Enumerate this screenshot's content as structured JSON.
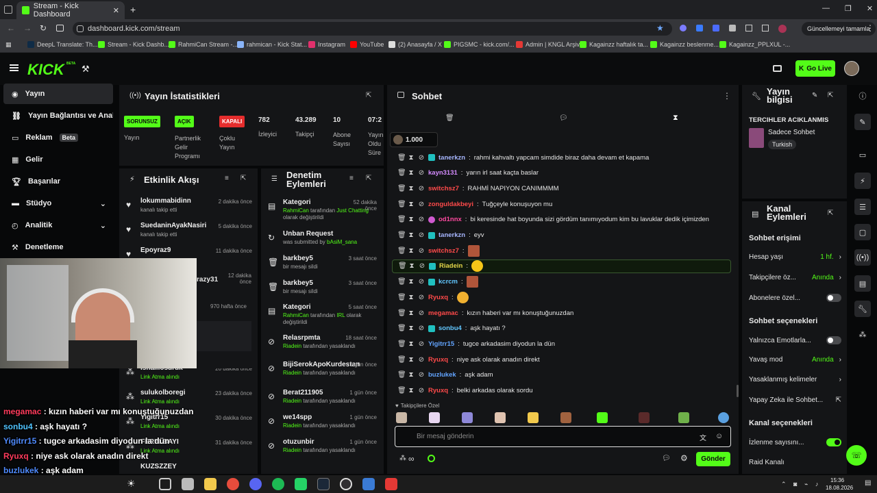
{
  "browser": {
    "tab_title": "Stream - Kick Dashboard",
    "url": "dashboard.kick.com/stream",
    "update_button": "Güncellemeyi tamamla",
    "bookmarks": [
      "DeepL Translate: Th...",
      "Stream - Kick Dashb...",
      "RahmiCan Stream -...",
      "rahmican - Kick Stat...",
      "Instagram",
      "YouTube",
      "(2) Anasayfa / X",
      "PIGSMC - kick.com/...",
      "Admin | KNGL Arşiv",
      "Kagainzz haftalık ta...",
      "Kagainzz beslenme...",
      "Kagainzz_PPLXUL -..."
    ]
  },
  "header": {
    "logo": "KICK",
    "beta": "BETA",
    "go_live": "Go Live"
  },
  "sidebar": {
    "items": [
      {
        "label": "Yayın"
      },
      {
        "label": "Yayın Bağlantısı ve Anahtarı"
      },
      {
        "label": "Reklam",
        "badge": "Beta"
      },
      {
        "label": "Gelir"
      },
      {
        "label": "Başarılar"
      },
      {
        "label": "Stüdyo"
      },
      {
        "label": "Analitik"
      },
      {
        "label": "Denetleme"
      }
    ]
  },
  "stats": {
    "title": "Yayın İstatistikleri",
    "cols": [
      {
        "badge": "SORUNSUZ",
        "label": "Yayın"
      },
      {
        "badge": "AÇIK",
        "label": "Partnerlik Gelir Programı"
      },
      {
        "badge": "KAPALI",
        "label": "Çoklu Yayın"
      },
      {
        "value": "782",
        "label": "İzleyici"
      },
      {
        "value": "43.289",
        "label": "Takipçi"
      },
      {
        "value": "10",
        "label": "Abone Sayısı"
      },
      {
        "value": "07:2",
        "label": "Yayın Oldu Süre"
      }
    ]
  },
  "activity": {
    "title": "Etkinlik Akışı",
    "items": [
      {
        "name": "lokummabidinn",
        "sub": "kanalı takip etti",
        "ago": "2 dakika önce"
      },
      {
        "name": "SuedaninAyakNasiri",
        "sub": "kanalı takip etti",
        "ago": "5 dakika önce"
      },
      {
        "name": "Epoyraz9",
        "sub": "",
        "ago": "11 dakika önce"
      },
      {
        "name": "razy31",
        "sub": "",
        "ago": "12 dakika önce"
      },
      {
        "name": "",
        "sub": "",
        "ago": "970 hafta önce"
      },
      {
        "name": "ishalliosuruk",
        "sub": "Link Atma alındı",
        "ago": "20 dakika önce"
      },
      {
        "name": "sulukolboregi",
        "sub": "Link Atma alındı",
        "ago": "23 dakika önce"
      },
      {
        "name": "Yigitrr15",
        "sub": "Link Atma alındı",
        "ago": "30 dakika önce"
      },
      {
        "name": "FERELBAYI",
        "sub": "Link Atma alındı",
        "ago": "31 dakika önce"
      },
      {
        "name": "KUZSZZEY",
        "sub": "",
        "ago": ""
      }
    ]
  },
  "moderation": {
    "title": "Denetim Eylemleri",
    "items": [
      {
        "name": "Kategori",
        "actor": "RahmiCan",
        "mid": " tarafından ",
        "hl": "Just Chatting",
        "tail": " olarak değiştirildi",
        "ago": "52 dakika önce"
      },
      {
        "name": "Unban Request",
        "actor": "",
        "mid": "was submitted by ",
        "hl": "bAsiM_sana",
        "tail": "",
        "ago": ""
      },
      {
        "name": "barkbey5",
        "actor": "",
        "mid": "bir mesajı sildi",
        "hl": "",
        "tail": "",
        "ago": "3 saat önce"
      },
      {
        "name": "barkbey5",
        "actor": "",
        "mid": "bir mesajı sildi",
        "hl": "",
        "tail": "",
        "ago": "3 saat önce"
      },
      {
        "name": "Kategori",
        "actor": "RahmiCan",
        "mid": " tarafından ",
        "hl": "IRL",
        "tail": " olarak değiştirildi",
        "ago": "5 saat önce"
      },
      {
        "name": "Relasrpmta",
        "actor": "Riadein",
        "mid": " tarafından yasaklandı",
        "hl": "",
        "tail": "",
        "ago": "18 saat önce"
      },
      {
        "name": "BijiSerokApoKurdestan21",
        "actor": "Riadein",
        "mid": " tarafından yasaklandı",
        "hl": "",
        "tail": "",
        "ago": "1 gün önce"
      },
      {
        "name": "Berat211905",
        "actor": "Riadein",
        "mid": " tarafından yasaklandı",
        "hl": "",
        "tail": "",
        "ago": "1 gün önce"
      },
      {
        "name": "we14spp",
        "actor": "Riadein",
        "mid": " tarafından yasaklandı",
        "hl": "",
        "tail": "",
        "ago": "1 gün önce"
      },
      {
        "name": "otuzunbir",
        "actor": "Riadein",
        "mid": " tarafından yasaklandı",
        "hl": "",
        "tail": "",
        "ago": "1 gün önce"
      }
    ]
  },
  "chat": {
    "title": "Sohbet",
    "pinned_amount": "1.000",
    "messages": [
      {
        "user": "tanerkzn",
        "color": "#a7b6ff",
        "text": "rahmi kahvaltı yapcam simdide biraz daha devam et kapama"
      },
      {
        "user": "kayn3131",
        "color": "#d58cff",
        "text": "yarın irl saat kaçta baslar"
      },
      {
        "user": "switchsz7",
        "color": "#ff4a4a",
        "text": "RAHMİ NAPIYON CANIMMMM"
      },
      {
        "user": "zonguldakbeyi",
        "color": "#ff4a4a",
        "text": "Tuğçeyle konuşuyon mu"
      },
      {
        "user": "od1nnx",
        "color": "#ff4aa0",
        "text": "bi keresinde hat boyunda sizi gördüm tanımıyodum kim bu lavuklar dedik içimizden"
      },
      {
        "user": "tanerkzn",
        "color": "#a7b6ff",
        "text": "eyv"
      },
      {
        "user": "switchsz7",
        "color": "#ff4a4a",
        "text": ""
      },
      {
        "user": "Riadein",
        "color": "#e6d84a",
        "text": ""
      },
      {
        "user": "kcrcm",
        "color": "#62c7ff",
        "text": ""
      },
      {
        "user": "Ryuxq",
        "color": "#ff4a4a",
        "text": ""
      },
      {
        "user": "megamac",
        "color": "#ff4a4a",
        "text": "kızın haberi var mı konuştuğunuzdan"
      },
      {
        "user": "sonbu4",
        "color": "#62c7ff",
        "text": "aşk hayatı ?"
      },
      {
        "user": "Yigitrr15",
        "color": "#62a4ff",
        "text": "tugce arkadasim diyodun la dün"
      },
      {
        "user": "Ryuxq",
        "color": "#ff4a4a",
        "text": "niye ask olarak anadın direkt"
      },
      {
        "user": "buzlukek",
        "color": "#62a4ff",
        "text": "aşk adam"
      },
      {
        "user": "Ryuxq",
        "color": "#ff4a4a",
        "text": "belki arkadas olarak sordu"
      }
    ],
    "emote_section": "Takipçilere Özel",
    "input_placeholder": "Bir mesaj gönderin",
    "send": "Gönder"
  },
  "stream_info": {
    "title": "Yayın bilgisi",
    "stream_title": "TERCIHLER ACIKLANMIS",
    "category": "Sadece Sohbet",
    "tag": "Turkish"
  },
  "channel_actions": {
    "title": "Kanal Eylemleri",
    "chat_access": "Sohbet erişimi",
    "account_age": "Hesap yaşı",
    "account_age_value": "1 hf.",
    "followers_only": "Takipçilere öz...",
    "followers_value": "Anında",
    "subs_only": "Abonelere özel...",
    "chat_options": "Sohbet seçenekleri",
    "emotes_only": "Yalnızca Emotlarla...",
    "slow_mode": "Yavaş mod",
    "slow_value": "Anında",
    "banned_words": "Yasaklanmış kelimeler",
    "ai_chat": "Yapay Zeka ile Sohbet...",
    "channel_options": "Kanal seçenekleri",
    "viewer_count": "İzlenme sayısını...",
    "raid": "Raid Kanalı"
  },
  "overlay_chat": [
    {
      "user": "megamac",
      "color": "#ff3b5c",
      "text": "kızın haberi var mı konuştuğunuzdan"
    },
    {
      "user": "sonbu4",
      "color": "#4fc3ff",
      "text": "aşk hayatı ?"
    },
    {
      "user": "Yigitrr15",
      "color": "#4f8bff",
      "text": "tugce arkadasim diyodun la dün"
    },
    {
      "user": "Ryuxq",
      "color": "#ff3b5c",
      "text": "niye ask olarak anadın direkt"
    },
    {
      "user": "buzlukek",
      "color": "#4f8bff",
      "text": "aşk adam"
    },
    {
      "user": "Ryuxq",
      "color": "#ff3b5c",
      "text": "belki arkadas olarak sordu"
    }
  ],
  "taskbar": {
    "time": "15:36",
    "date": "18.08.2026"
  },
  "colors": {
    "accent": "#53fc18",
    "panel": "#141517",
    "bg": "#070809"
  }
}
